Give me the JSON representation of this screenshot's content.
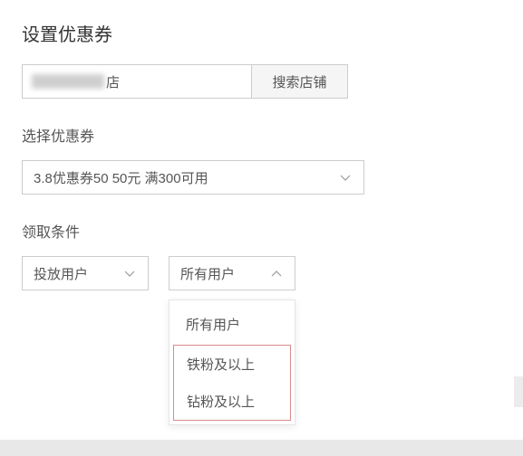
{
  "page_title": "设置优惠券",
  "search": {
    "value_suffix": "店",
    "button_label": "搜索店铺"
  },
  "coupon_section": {
    "label": "选择优惠券",
    "selected": "3.8优惠券50 50元 满300可用"
  },
  "condition_section": {
    "label": "领取条件",
    "left_select": "投放用户",
    "right_select": "所有用户",
    "dropdown_options": {
      "opt1": "所有用户",
      "opt2": "铁粉及以上",
      "opt3": "钻粉及以上"
    }
  }
}
